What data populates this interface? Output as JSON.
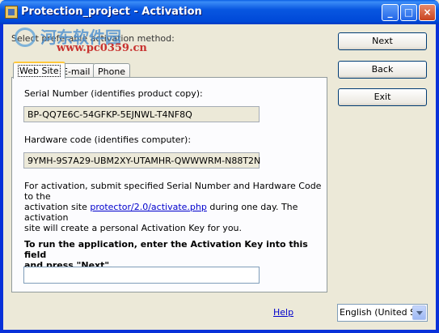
{
  "window": {
    "title": "Protection_project - Activation",
    "minimize": "_",
    "maximize": "□",
    "close": "×"
  },
  "watermark": {
    "cn_text": "河东软件园",
    "url": "www.pc0359.cn"
  },
  "prompt": "Select preferable activation method:",
  "tabs": [
    "Web Site",
    "E-mail",
    "Phone"
  ],
  "panel": {
    "serial_label": "Serial Number (identifies product copy):",
    "serial_value": "BP-QQ7E6C-54GFKP-5EJNWL-T4NF8Q",
    "hardware_label": "Hardware code (identifies computer):",
    "hardware_value": "9YMH-9S7A29-UBM2XY-UTAMHR-QWWWRM-N88T2N",
    "info_line1": "For activation, submit specified Serial Number and Hardware Code to the",
    "info_pre_link": "activation site ",
    "info_link": "protector/2.0/activate.php",
    "info_post_link": " during one day. The activation",
    "info_line3": "site will create a personal Activation Key for you.",
    "key_line1": "To run the application, enter the Activation Key into this field",
    "key_line2": "and press \"Next\".",
    "key_value": ""
  },
  "buttons": {
    "next": "Next",
    "back": "Back",
    "exit": "Exit"
  },
  "help": "Help",
  "language": "English (United States)"
}
